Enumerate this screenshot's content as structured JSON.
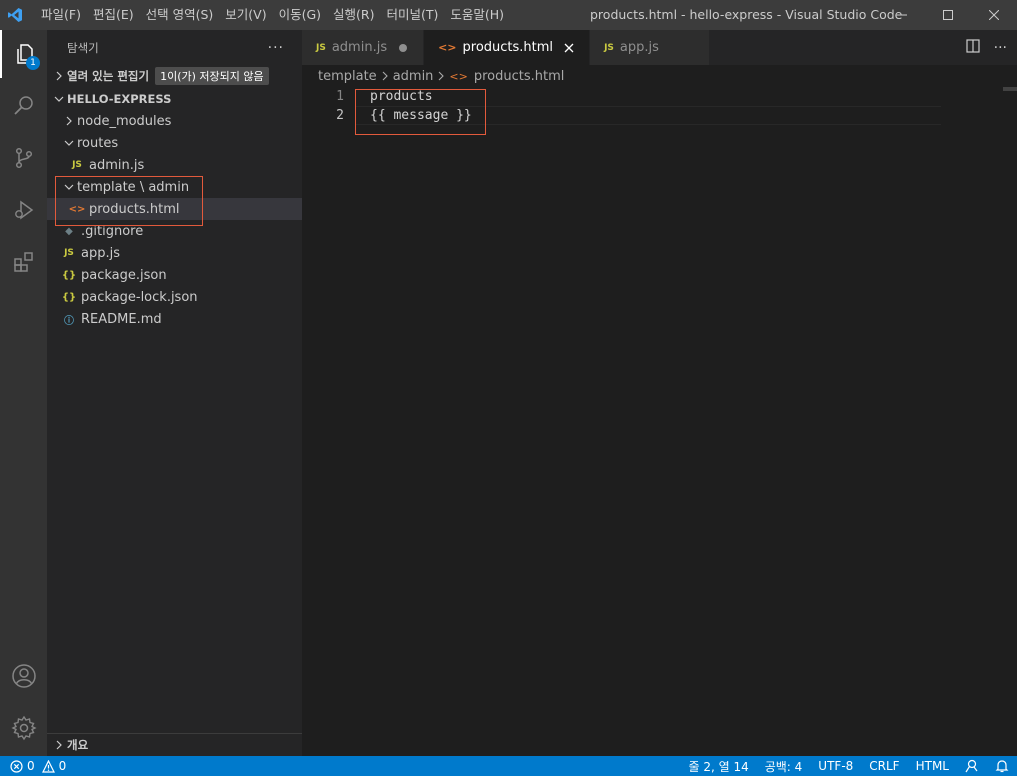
{
  "window": {
    "title": "products.html - hello-express - Visual Studio Code",
    "menu": [
      "파일(F)",
      "편집(E)",
      "선택 영역(S)",
      "보기(V)",
      "이동(G)",
      "실행(R)",
      "터미널(T)",
      "도움말(H)"
    ]
  },
  "activity_bar": {
    "explorer_badge": "1",
    "items": [
      "explorer-icon",
      "search-icon",
      "source-control-icon",
      "run-debug-icon",
      "extensions-icon"
    ],
    "bottom_items": [
      "account-icon",
      "settings-gear-icon"
    ]
  },
  "sidebar": {
    "title": "탐색기",
    "more": "···",
    "open_editors": {
      "label": "열려 있는 편집기",
      "badge": "1이(가) 저장되지 않음"
    },
    "project": "HELLO-EXPRESS",
    "tree": [
      {
        "label": "node_modules",
        "type": "folder",
        "expanded": false
      },
      {
        "label": "routes",
        "type": "folder",
        "expanded": true
      },
      {
        "label": "admin.js",
        "type": "js"
      },
      {
        "label": "template \\ admin",
        "type": "folder",
        "expanded": true
      },
      {
        "label": "products.html",
        "type": "html",
        "selected": true
      },
      {
        "label": ".gitignore",
        "type": "git"
      },
      {
        "label": "app.js",
        "type": "js"
      },
      {
        "label": "package.json",
        "type": "json"
      },
      {
        "label": "package-lock.json",
        "type": "json"
      },
      {
        "label": "README.md",
        "type": "info"
      }
    ],
    "outline": "개요"
  },
  "icons": {
    "js": "JS",
    "html": "<>",
    "json": "{}",
    "info": "ⓘ",
    "git": "◆"
  },
  "tabs": [
    {
      "label": "admin.js",
      "type": "js",
      "modified": true,
      "active": false
    },
    {
      "label": "products.html",
      "type": "html",
      "modified": false,
      "active": true
    },
    {
      "label": "app.js",
      "type": "js",
      "modified": false,
      "active": false
    }
  ],
  "breadcrumb": [
    "template",
    "admin",
    "products.html"
  ],
  "code": {
    "lines": [
      {
        "number": "1",
        "text": "products"
      },
      {
        "number": "2",
        "text": "{{ message }}"
      }
    ]
  },
  "status_bar": {
    "errors": "0",
    "warnings": "0",
    "position": "줄 2, 열 14",
    "indent": "공백: 4",
    "encoding": "UTF-8",
    "eol": "CRLF",
    "language": "HTML"
  },
  "colors": {
    "accent": "#007acc",
    "annotation": "#e25a3c"
  }
}
